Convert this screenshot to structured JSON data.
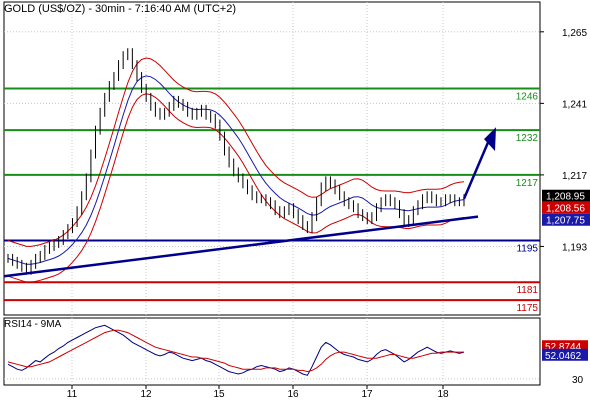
{
  "chart_data": [
    {
      "type": "candlestick",
      "title": "GOLD (US$/OZ) - 30min - 7:16:40 AM (UTC+2)",
      "y_ticks": [
        1193,
        1217,
        1241,
        1265
      ],
      "ylim": [
        1170,
        1275
      ],
      "x_ticks": [
        "11",
        "12",
        "15",
        "16",
        "17",
        "18"
      ],
      "grid": true,
      "levels": [
        {
          "value": 1246,
          "label": "1246",
          "color": "#1a8c1a"
        },
        {
          "value": 1232,
          "label": "1232",
          "color": "#1a8c1a"
        },
        {
          "value": 1217,
          "label": "1217",
          "color": "#1a8c1a"
        },
        {
          "value": 1195,
          "label": "1195",
          "color": "#00008b"
        },
        {
          "value": 1181,
          "label": "1181",
          "color": "#cc0000"
        },
        {
          "value": 1175,
          "label": "1175",
          "color": "#cc0000"
        }
      ],
      "price_tags": [
        {
          "label": "1,208.95",
          "bg": "#000000",
          "fg": "#ffffff"
        },
        {
          "label": "1,208.56",
          "bg": "#cc0000",
          "fg": "#ffffff"
        },
        {
          "label": "1,207.75",
          "bg": "#1a1aa8",
          "fg": "#ffffff"
        }
      ],
      "close": [
        1189,
        1188,
        1187,
        1186,
        1185,
        1187,
        1189,
        1190,
        1192,
        1193,
        1194,
        1195,
        1197,
        1199,
        1201,
        1205,
        1210,
        1216,
        1224,
        1232,
        1238,
        1243,
        1247,
        1250,
        1254,
        1257,
        1258,
        1254,
        1250,
        1246,
        1243,
        1240,
        1238,
        1237,
        1238,
        1240,
        1242,
        1241,
        1240,
        1238,
        1237,
        1238,
        1239,
        1237,
        1236,
        1234,
        1230,
        1225,
        1221,
        1218,
        1216,
        1214,
        1212,
        1210,
        1209,
        1209,
        1208,
        1207,
        1205,
        1204,
        1205,
        1206,
        1204,
        1202,
        1200,
        1199,
        1203,
        1208,
        1213,
        1215,
        1214,
        1212,
        1210,
        1208,
        1207,
        1206,
        1204,
        1203,
        1202,
        1203,
        1206,
        1208,
        1209,
        1208,
        1207,
        1204,
        1201,
        1202,
        1205,
        1207,
        1209,
        1210,
        1209,
        1208,
        1208,
        1209,
        1209,
        1208,
        1208,
        1209
      ],
      "bands": {
        "colors": {
          "upper": "#cc0000",
          "lower": "#cc0000",
          "ma": "#1a1aa8"
        }
      }
    },
    {
      "type": "line",
      "title": "RSI14 - 9MA",
      "y_ticks": [
        30
      ],
      "ylim": [
        25,
        80
      ],
      "series": [
        {
          "name": "RSI14",
          "color": "#000080",
          "values": [
            42,
            40,
            38,
            37,
            39,
            42,
            45,
            44,
            47,
            50,
            52,
            55,
            57,
            60,
            62,
            64,
            66,
            68,
            70,
            72,
            73,
            74,
            72,
            70,
            68,
            66,
            63,
            60,
            58,
            56,
            54,
            52,
            50,
            49,
            50,
            52,
            51,
            49,
            47,
            46,
            45,
            46,
            47,
            45,
            44,
            42,
            40,
            38,
            36,
            35,
            34,
            35,
            37,
            38,
            40,
            41,
            40,
            39,
            38,
            36,
            37,
            39,
            38,
            36,
            34,
            33,
            40,
            48,
            56,
            60,
            58,
            55,
            52,
            50,
            49,
            48,
            46,
            45,
            44,
            46,
            50,
            53,
            54,
            52,
            50,
            47,
            44,
            46,
            49,
            52,
            54,
            56,
            54,
            52,
            51,
            52,
            53,
            52,
            51,
            52
          ]
        },
        {
          "name": "9MA",
          "color": "#cc0000",
          "values": [
            44,
            43,
            42,
            41,
            40,
            40,
            41,
            42,
            43,
            44,
            46,
            48,
            50,
            52,
            54,
            56,
            58,
            60,
            62,
            64,
            66,
            68,
            69,
            70,
            70,
            69,
            68,
            66,
            64,
            62,
            60,
            58,
            56,
            55,
            54,
            53,
            52,
            51,
            50,
            49,
            48,
            48,
            47,
            47,
            46,
            45,
            44,
            43,
            41,
            40,
            39,
            38,
            38,
            38,
            38,
            38,
            39,
            39,
            39,
            38,
            38,
            38,
            38,
            37,
            37,
            36,
            37,
            39,
            42,
            46,
            49,
            51,
            52,
            52,
            51,
            50,
            49,
            48,
            47,
            47,
            47,
            48,
            49,
            50,
            50,
            49,
            48,
            47,
            47,
            48,
            49,
            50,
            51,
            51,
            52,
            52,
            52,
            52,
            52,
            52
          ]
        }
      ],
      "value_tags": [
        {
          "label": "52.8744",
          "bg": "#cc0000",
          "fg": "#ffffff"
        },
        {
          "label": "52.0462",
          "bg": "#1a1aa8",
          "fg": "#ffffff"
        }
      ]
    }
  ]
}
